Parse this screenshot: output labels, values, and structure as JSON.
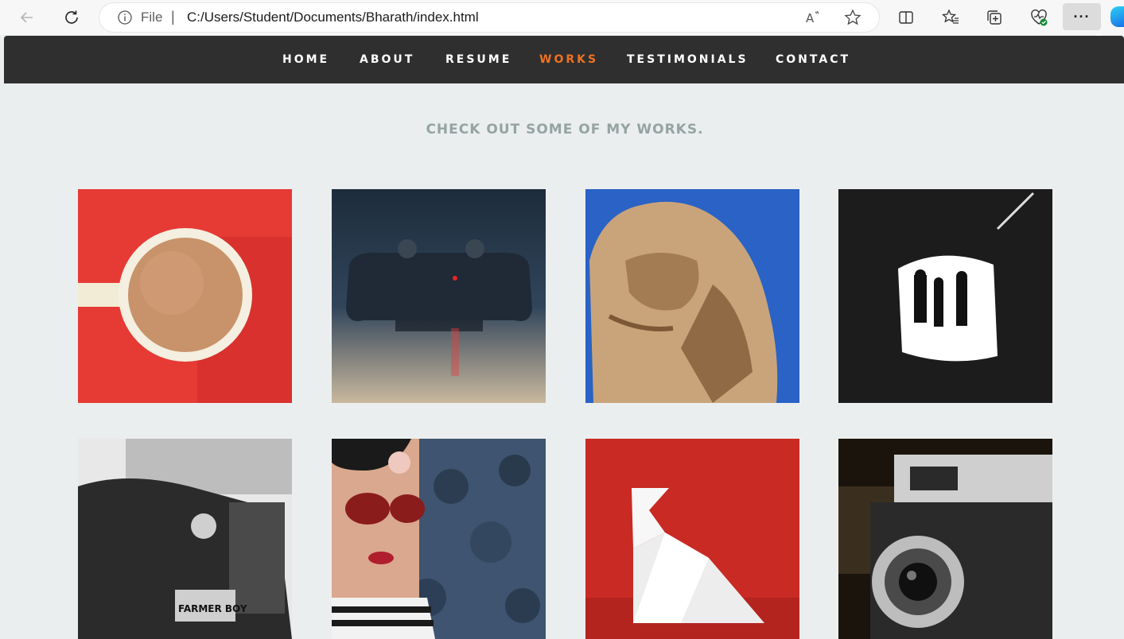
{
  "browser": {
    "address_prefix": "File",
    "url": "C:/Users/Student/Documents/Bharath/index.html",
    "icons": [
      "back-arrow-icon",
      "refresh-icon",
      "info-icon",
      "read-aloud-icon",
      "favorite-star-icon",
      "split-screen-icon",
      "favorites-icon",
      "collections-icon",
      "browser-essentials-icon",
      "more-icon",
      "copilot-icon"
    ]
  },
  "nav": {
    "items": [
      {
        "label": "HOME"
      },
      {
        "label": "ABOUT"
      },
      {
        "label": "RESUME"
      },
      {
        "label": "WORKS"
      },
      {
        "label": "TESTIMONIALS"
      },
      {
        "label": "CONTACT"
      }
    ],
    "active_color": "#f0721e",
    "bar_color": "#2f2f2f"
  },
  "portfolio": {
    "heading": "CHECK OUT SOME OF MY WORKS.",
    "items": [
      {
        "subject": "coffee-cup"
      },
      {
        "subject": "game-controller"
      },
      {
        "subject": "lion-statue"
      },
      {
        "subject": "cave-silhouettes"
      },
      {
        "subject": "vintage-car"
      },
      {
        "subject": "woman-sunglasses"
      },
      {
        "subject": "origami-bird"
      },
      {
        "subject": "vintage-camera"
      }
    ]
  },
  "colors": {
    "page_bg": "#ebeeee",
    "heading": "#95a3a3"
  }
}
